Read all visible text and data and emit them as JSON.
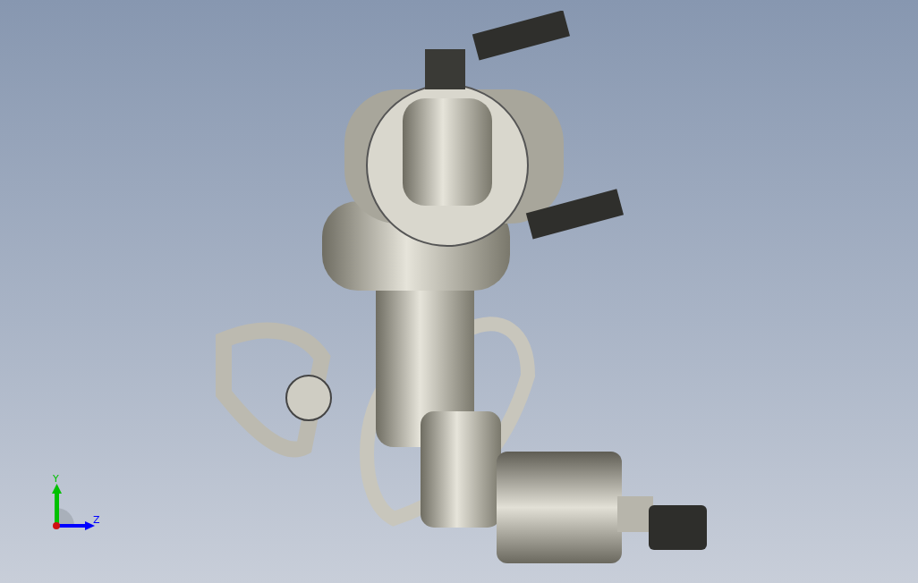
{
  "viewport": {
    "triad": {
      "axes": [
        {
          "label": "Y",
          "color": "#00c000"
        },
        {
          "label": "Z",
          "color": "#0000ff"
        }
      ]
    }
  }
}
